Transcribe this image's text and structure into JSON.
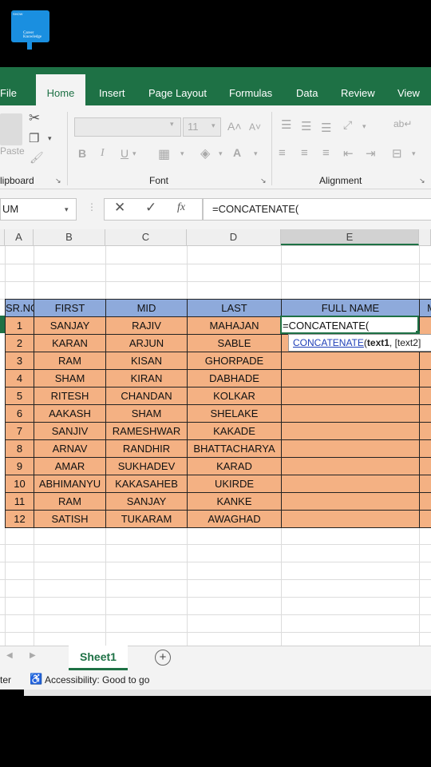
{
  "logo": {
    "small_text": "SHOW",
    "caption": "Career Knowledge"
  },
  "ribbon": {
    "tabs": [
      "File",
      "Home",
      "Insert",
      "Page Layout",
      "Formulas",
      "Data",
      "Review",
      "View"
    ],
    "groups": {
      "clipboard": "lipboard",
      "font": "Font",
      "alignment": "Alignment"
    },
    "paste_label": "Paste",
    "font_size": "11",
    "font_buttons": [
      "B",
      "I",
      "U"
    ]
  },
  "formula_bar": {
    "name_box": "UM",
    "cancel": "✕",
    "enter": "✓",
    "fx": "fx",
    "formula": "=CONCATENATE("
  },
  "columns": [
    "A",
    "B",
    "C",
    "D",
    "E"
  ],
  "table": {
    "headers": [
      "SR.NO",
      "FIRST",
      "MID",
      "LAST",
      "FULL NAME",
      "M"
    ],
    "rows": [
      [
        "1",
        "SANJAY",
        "RAJIV",
        "MAHAJAN",
        "=CONCATENATE("
      ],
      [
        "2",
        "KARAN",
        "ARJUN",
        "SABLE",
        ""
      ],
      [
        "3",
        "RAM",
        "KISAN",
        "GHORPADE",
        ""
      ],
      [
        "4",
        "SHAM",
        "KIRAN",
        "DABHADE",
        ""
      ],
      [
        "5",
        "RITESH",
        "CHANDAN",
        "KOLKAR",
        ""
      ],
      [
        "6",
        "AAKASH",
        "SHAM",
        "SHELAKE",
        ""
      ],
      [
        "7",
        "SANJIV",
        "RAMESHWAR",
        "KAKADE",
        ""
      ],
      [
        "8",
        "ARNAV",
        "RANDHIR",
        "BHATTACHARYA",
        ""
      ],
      [
        "9",
        "AMAR",
        "SUKHADEV",
        "KARAD",
        ""
      ],
      [
        "10",
        "ABHIMANYU",
        "KAKASAHEB",
        "UKIRDE",
        ""
      ],
      [
        "11",
        "RAM",
        "SANJAY",
        "KANKE",
        ""
      ],
      [
        "12",
        "SATISH",
        "TUKARAM",
        "AWAGHAD",
        ""
      ]
    ]
  },
  "tooltip": {
    "function": "CONCATENATE",
    "open": "(",
    "arg1": "text1",
    "rest": ", [text2]"
  },
  "sheet_tabs": {
    "active": "Sheet1",
    "add": "+"
  },
  "status": {
    "left": "ter",
    "accessibility": "Accessibility: Good to go"
  }
}
